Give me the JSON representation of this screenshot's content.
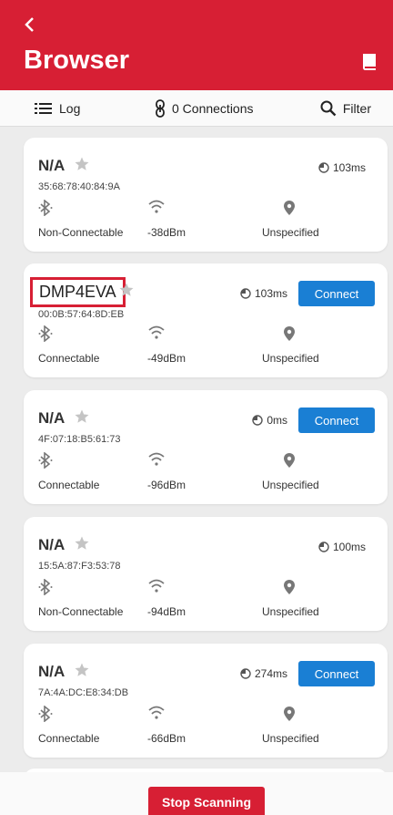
{
  "header": {
    "title": "Browser"
  },
  "toolbar": {
    "log_label": "Log",
    "connections_label": "0 Connections",
    "filter_label": "Filter"
  },
  "devices": [
    {
      "name": "N/A",
      "address": "35:68:78:40:84:9A",
      "interval": "103ms",
      "connectable": "Non-Connectable",
      "rssi": "-38dBm",
      "location": "Unspecified",
      "has_connect": false
    },
    {
      "name": "DMP4EVA",
      "address": "00:0B:57:64:8D:EB",
      "interval": "103ms",
      "connectable": "Connectable",
      "rssi": "-49dBm",
      "location": "Unspecified",
      "has_connect": true,
      "highlighted": true
    },
    {
      "name": "N/A",
      "address": "4F:07:18:B5:61:73",
      "interval": "0ms",
      "connectable": "Connectable",
      "rssi": "-96dBm",
      "location": "Unspecified",
      "has_connect": true
    },
    {
      "name": "N/A",
      "address": "15:5A:87:F3:53:78",
      "interval": "100ms",
      "connectable": "Non-Connectable",
      "rssi": "-94dBm",
      "location": "Unspecified",
      "has_connect": false
    },
    {
      "name": "N/A",
      "address": "7A:4A:DC:E8:34:DB",
      "interval": "274ms",
      "connectable": "Connectable",
      "rssi": "-66dBm",
      "location": "Unspecified",
      "has_connect": true
    }
  ],
  "connect_label": "Connect",
  "footer": {
    "stop_label": "Stop Scanning"
  },
  "colors": {
    "brand_red": "#d71f34",
    "connect_blue": "#1a7fd4",
    "highlight_border": "#d71f34"
  },
  "icons": [
    "back-arrow-icon",
    "book-icon",
    "list-icon",
    "link-icon",
    "search-icon",
    "star-icon",
    "clock-icon",
    "bluetooth-icon",
    "wifi-icon",
    "location-pin-icon"
  ]
}
